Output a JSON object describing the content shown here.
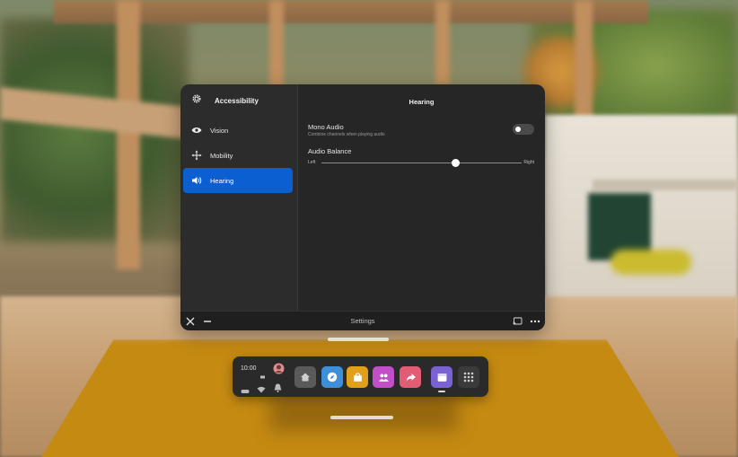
{
  "sidebar": {
    "title": "Accessibility",
    "items": [
      {
        "label": "Vision",
        "icon": "eye-icon"
      },
      {
        "label": "Mobility",
        "icon": "move-arrows-icon"
      },
      {
        "label": "Hearing",
        "icon": "speaker-icon",
        "active": true
      }
    ]
  },
  "content": {
    "title": "Hearing",
    "mono_audio": {
      "label": "Mono Audio",
      "description": "Combine channels when playing audio",
      "enabled": false
    },
    "audio_balance": {
      "label": "Audio Balance",
      "left_label": "Left",
      "right_label": "Right",
      "value": 0.67
    }
  },
  "bottom_bar": {
    "title": "Settings"
  },
  "dock": {
    "time": "10:00",
    "apps": [
      {
        "name": "home-icon",
        "color": "#5a5a5a"
      },
      {
        "name": "explore-icon",
        "color": "#3d8fd8"
      },
      {
        "name": "store-icon",
        "color": "#e1a019"
      },
      {
        "name": "people-icon",
        "color": "#c24fc8"
      },
      {
        "name": "share-icon",
        "color": "#e25d74"
      },
      {
        "name": "window-icon",
        "color": "#7b62d2",
        "active": true
      },
      {
        "name": "app-grid-icon",
        "color": "#3a3a3a"
      }
    ]
  },
  "colors": {
    "accent": "#0c5fd0",
    "panel": "#262626"
  }
}
